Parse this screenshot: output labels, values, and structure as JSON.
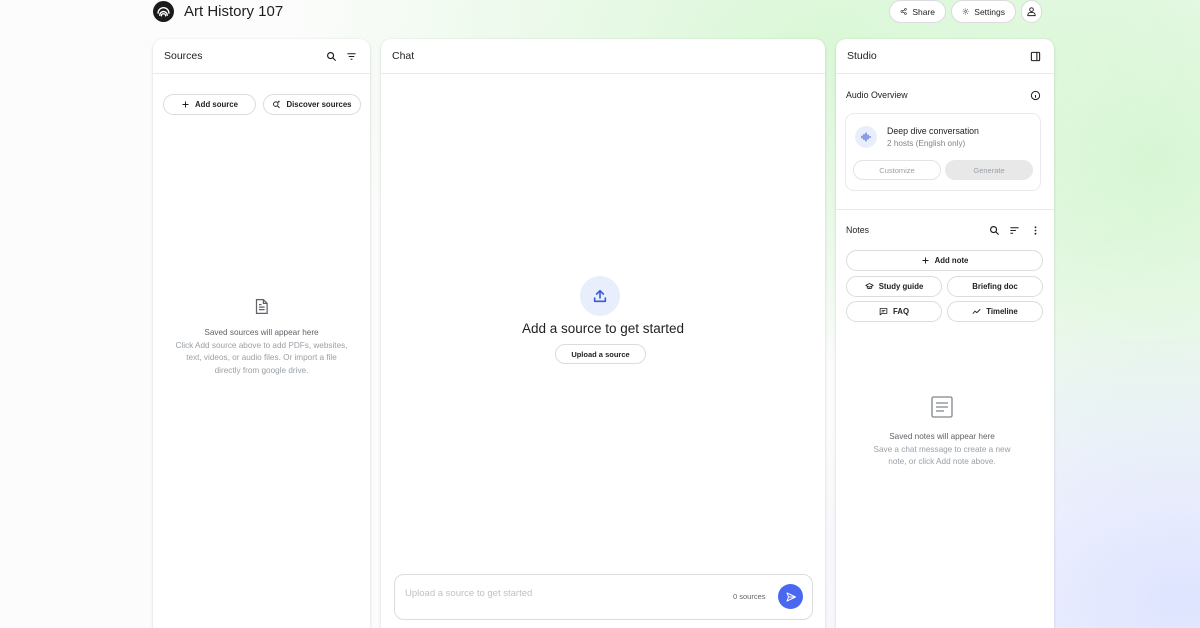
{
  "header": {
    "title": "Art History 107",
    "share_label": "Share",
    "settings_label": "Settings"
  },
  "sources": {
    "title": "Sources",
    "add_label": "Add source",
    "discover_label": "Discover sources",
    "empty_title": "Saved sources will appear here",
    "empty_line1": "Click Add source above to add PDFs, websites,",
    "empty_line2": "text, videos, or audio files. Or import a file",
    "empty_line3": "directly from google drive."
  },
  "chat": {
    "title": "Chat",
    "cta": "Add a source to get started",
    "upload_label": "Upload a source",
    "input_placeholder": "Upload a source to get started",
    "sources_count": "0 sources"
  },
  "studio": {
    "title": "Studio",
    "audio_overview_label": "Audio Overview",
    "card_title": "Deep dive conversation",
    "card_subtitle": "2 hosts (English only)",
    "customize_label": "Customize",
    "generate_label": "Generate",
    "notes_label": "Notes",
    "add_note_label": "Add note",
    "study_guide_label": "Study guide",
    "briefing_doc_label": "Briefing doc",
    "faq_label": "FAQ",
    "timeline_label": "Timeline",
    "empty_title": "Saved notes will appear here",
    "empty_line1": "Save a chat message to create a new",
    "empty_line2": "note, or click Add note above."
  },
  "colors": {
    "accent": "#4a67f0",
    "icon_bg": "#e8eefc",
    "border": "#dadce0"
  },
  "icons": [
    "app-logo-icon",
    "share-icon",
    "gear-icon",
    "user-icon",
    "search-icon",
    "filter-icon",
    "plus-icon",
    "discover-icon",
    "document-icon",
    "upload-icon",
    "send-icon",
    "panel-toggle-icon",
    "info-icon",
    "audio-wave-icon",
    "sort-icon",
    "more-vert-icon",
    "graduation-cap-icon",
    "faq-icon",
    "timeline-icon",
    "note-icon"
  ]
}
